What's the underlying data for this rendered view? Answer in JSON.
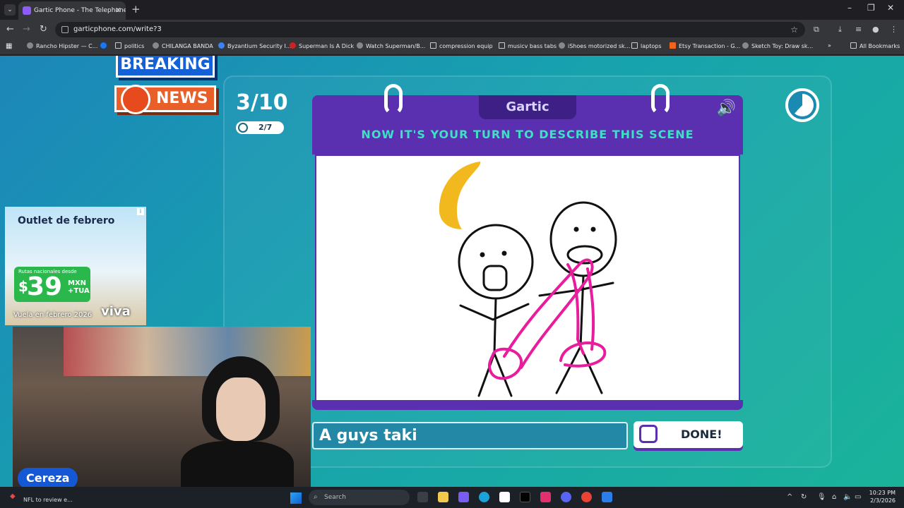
{
  "browser": {
    "tab_title": "Gartic Phone - The Telephone Game",
    "url": "garticphone.com/write?3",
    "bookmarks": [
      "Rancho Hipster — C...",
      "politics",
      "CHILANGA BANDA",
      "Byzantium Security I...",
      "Superman Is A Dick",
      "Watch Superman/B...",
      "compression equip",
      "musicv bass tabs",
      "iShoes motorized sk...",
      "laptops",
      "Etsy Transaction - G...",
      "Sketch Toy: Draw sk..."
    ],
    "all_bookmarks": "All Bookmarks"
  },
  "overlay": {
    "breaking": "BREAKING",
    "news": "NEWS"
  },
  "game": {
    "round": "3/10",
    "players_done": "2/7",
    "brand": "Gartic",
    "prompt": "NOW IT'S YOUR TURN TO DESCRIBE THIS SCENE",
    "answer_value": "A guys taki",
    "done_label": "DONE!"
  },
  "ad": {
    "title": "Outlet de febrero",
    "small": "Rutas nacionales desde",
    "dollar": "$",
    "amount": "39",
    "currency": "MXN",
    "tax": "+TUA",
    "footer": "Vuela en febrero 2026",
    "brand": "viva"
  },
  "webcam": {
    "name": "Cereza"
  },
  "taskbar": {
    "news": "NFL to review e...",
    "search_placeholder": "Search",
    "time": "10:23 PM",
    "date": "2/3/2026"
  },
  "colors": {
    "card_purple": "#5a2fb0",
    "prompt_teal": "#3ee1c4",
    "drawing_pink": "#e81c9c",
    "banana_yellow": "#f2b91f"
  }
}
